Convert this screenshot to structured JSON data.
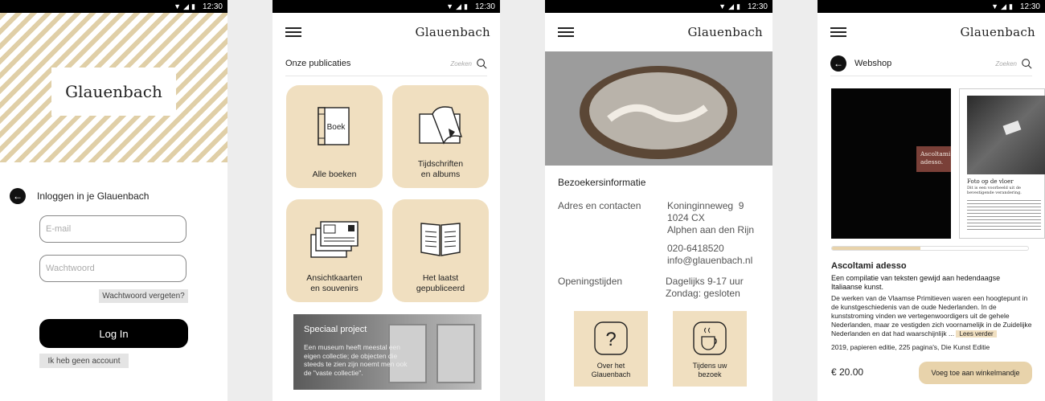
{
  "status_time": "12:30",
  "brand": "Glauenbach",
  "login": {
    "title": "Inloggen in je Glauenbach",
    "email_placeholder": "E-mail",
    "password_placeholder": "Wachtwoord",
    "forgot": "Wachtwoord vergeten?",
    "login_button": "Log In",
    "no_account": "Ik heb geen account"
  },
  "publications": {
    "title": "Onze publicaties",
    "search_placeholder": "Zoeken",
    "tiles": [
      {
        "label": "Alle boeken",
        "icon_text": "Boek",
        "icon": "book-icon"
      },
      {
        "label": "Tijdschriften\nen albums",
        "icon": "magazine-icon"
      },
      {
        "label": "Ansichtkaarten\nen souvenirs",
        "icon": "postcards-icon"
      },
      {
        "label": "Het laatst\ngepubliceerd",
        "icon": "open-book-icon"
      }
    ],
    "special": {
      "title": "Speciaal project",
      "text": "Een museum heeft meestal een eigen collectie; de objecten die steeds te zien zijn noemt men ook de \"vaste collectie\"."
    }
  },
  "visitor": {
    "title": "Bezoekersinformatie",
    "address_label": "Adres en contacten",
    "address": [
      "Koninginneweg  9",
      "1024 CX",
      "Alphen aan den Rijn"
    ],
    "phone": "020-6418520",
    "email": "info@glauenbach.nl",
    "hours_label": "Openingstijden",
    "hours": [
      "Dagelijks 9-17 uur",
      "Zondag: gesloten"
    ],
    "buttons": [
      {
        "label": "Over het\nGlauenbach",
        "icon": "question-icon"
      },
      {
        "label": "Tijdens uw\nbezoek",
        "icon": "coffee-cup-icon"
      }
    ]
  },
  "webshop": {
    "title": "Webshop",
    "search_placeholder": "Zoeken",
    "cover_text": "Ascoltami\nadesso.",
    "page_heading": "Foto op de vloer",
    "page_subheading": "Dit is een voorbeeld uit de bevestigende verandering.",
    "progress": 0.45,
    "product_title": "Ascoltami adesso",
    "product_subtitle": "Een compilatie van teksten gewijd aan hedendaagse Italiaanse kunst.",
    "description": "De werken van de Vlaamse Primitieven waren een hoogtepunt in de kunstgeschiedenis van de oude Nederlanden. In de kunststroming vinden we vertegenwoordigers uit de gehele Nederlanden, maar ze vestigden zich voornamelijk in de Zuidelijke Nederlanden en dat had waarschijnlijk ...",
    "read_more": "Lees verder",
    "meta": "2019, papieren editie, 225 pagina's, Die Kunst Editie",
    "price": "€ 20.00",
    "add_to_cart": "Voeg toe aan winkelmandje"
  },
  "colors": {
    "accent": "#f0dfc0",
    "accent_dark": "#e8d3ab",
    "cover_red": "#7a4038"
  }
}
